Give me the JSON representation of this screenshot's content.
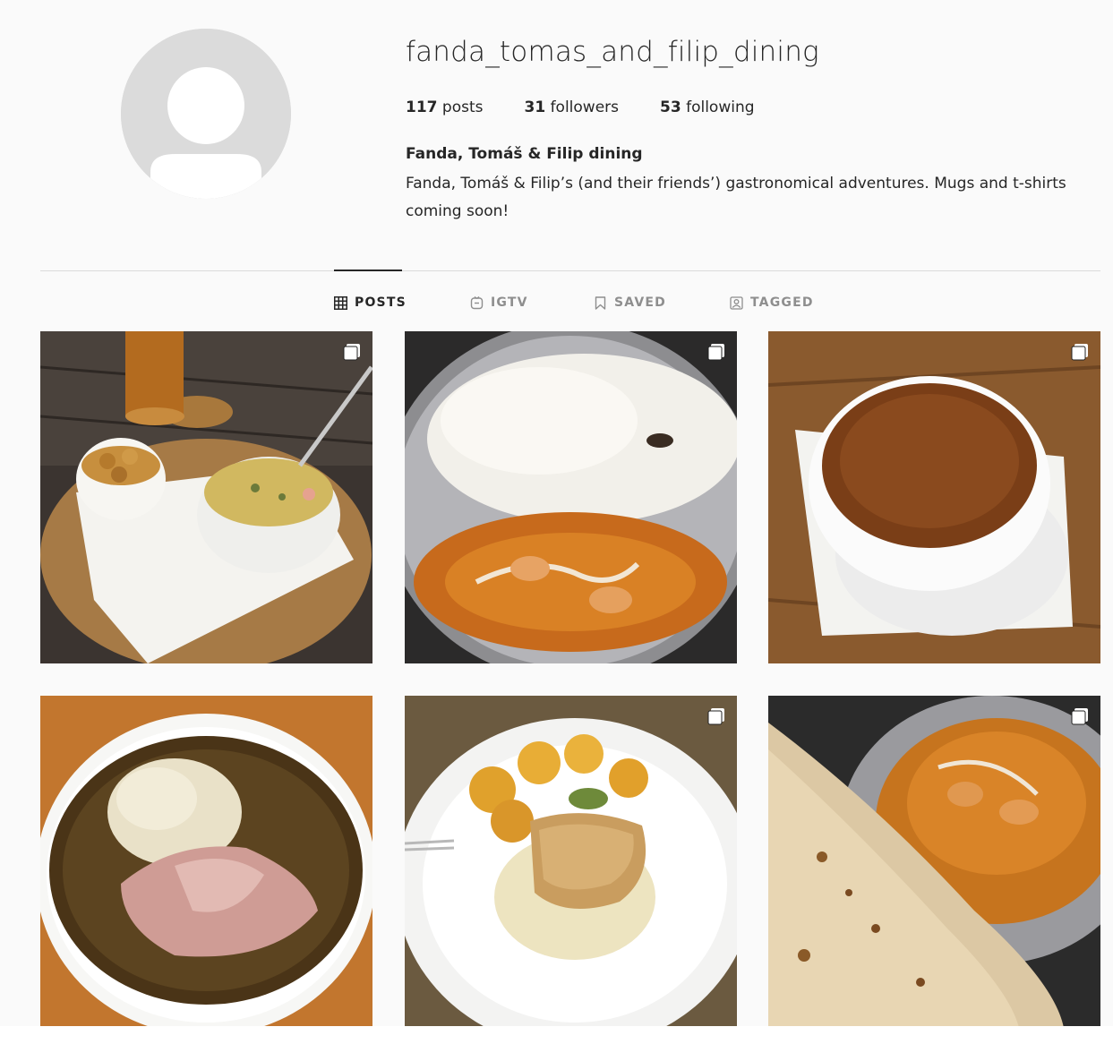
{
  "profile": {
    "username": "fanda_tomas_and_filip_dining",
    "full_name": "Fanda, Tomáš & Filip dining",
    "bio": "Fanda, Tomáš & Filip’s (and their friends’) gastronomical adventures. Mugs and t-shirts coming soon!",
    "avatar_icon": "default-avatar-icon"
  },
  "stats": {
    "posts_count": "117",
    "posts_label": "posts",
    "followers_count": "31",
    "followers_label": "followers",
    "following_count": "53",
    "following_label": "following"
  },
  "tabs": [
    {
      "label": "POSTS",
      "icon": "grid-icon",
      "active": true
    },
    {
      "label": "IGTV",
      "icon": "igtv-icon",
      "active": false
    },
    {
      "label": "SAVED",
      "icon": "bookmark-icon",
      "active": false
    },
    {
      "label": "TAGGED",
      "icon": "tagged-icon",
      "active": false
    }
  ],
  "posts": [
    {
      "subject": "soup with croutons and beer",
      "carousel": true
    },
    {
      "subject": "rice with butter chicken",
      "carousel": true
    },
    {
      "subject": "brown soup in white bowl",
      "carousel": true
    },
    {
      "subject": "potato pancake with sauerkraut and ham",
      "carousel": false
    },
    {
      "subject": "fish with potatoes and cream sauce",
      "carousel": true
    },
    {
      "subject": "naan with butter chicken",
      "carousel": true
    }
  ],
  "colors": {
    "text_primary": "#262626",
    "text_secondary": "#8e8e8e",
    "border": "#dbdbdb",
    "background": "#fafafa"
  }
}
